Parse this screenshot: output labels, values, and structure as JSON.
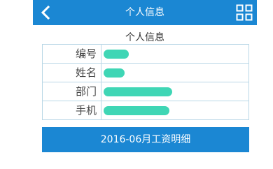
{
  "header": {
    "title": "个人信息",
    "back_icon": "chevron-left-icon",
    "menu_icon": "grid-icon"
  },
  "section": {
    "title": "个人信息"
  },
  "info": {
    "rows": [
      {
        "label": "编号"
      },
      {
        "label": "姓名"
      },
      {
        "label": "部门"
      },
      {
        "label": "手机"
      }
    ]
  },
  "detail_button": {
    "label": "2016-06月工资明细"
  },
  "colors": {
    "accent": "#1b87d3",
    "border": "#b9d7e6",
    "redaction": "#3fd6b5"
  }
}
